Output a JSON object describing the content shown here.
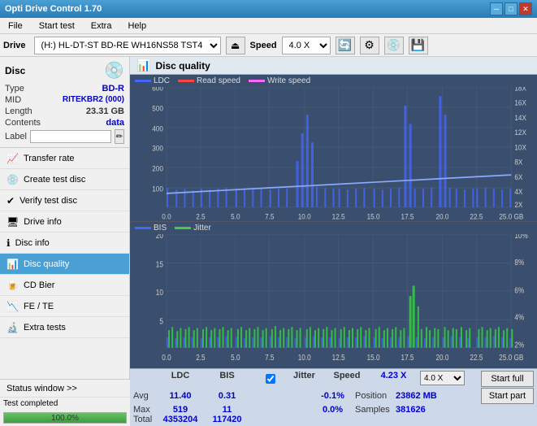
{
  "titleBar": {
    "title": "Opti Drive Control 1.70",
    "minimizeIcon": "─",
    "maximizeIcon": "□",
    "closeIcon": "✕"
  },
  "menuBar": {
    "items": [
      "File",
      "Start test",
      "Extra",
      "Help"
    ]
  },
  "driveToolbar": {
    "driveLabel": "Drive",
    "driveValue": "(H:) HL-DT-ST BD-RE  WH16NS58 TST4",
    "speedLabel": "Speed",
    "speedValue": "4.0 X"
  },
  "disc": {
    "title": "Disc",
    "typeLabel": "Type",
    "typeValue": "BD-R",
    "midLabel": "MID",
    "midValue": "RITEKBR2 (000)",
    "lengthLabel": "Length",
    "lengthValue": "23.31 GB",
    "contentsLabel": "Contents",
    "contentsValue": "data",
    "labelLabel": "Label",
    "labelValue": ""
  },
  "navItems": [
    {
      "id": "transfer-rate",
      "label": "Transfer rate",
      "icon": "📈"
    },
    {
      "id": "create-test-disc",
      "label": "Create test disc",
      "icon": "💿"
    },
    {
      "id": "verify-test-disc",
      "label": "Verify test disc",
      "icon": "✔"
    },
    {
      "id": "drive-info",
      "label": "Drive info",
      "icon": "🖥"
    },
    {
      "id": "disc-info",
      "label": "Disc info",
      "icon": "ℹ"
    },
    {
      "id": "disc-quality",
      "label": "Disc quality",
      "icon": "📊",
      "active": true
    },
    {
      "id": "cd-bier",
      "label": "CD Bier",
      "icon": "🍺"
    },
    {
      "id": "fe-te",
      "label": "FE / TE",
      "icon": "📉"
    },
    {
      "id": "extra-tests",
      "label": "Extra tests",
      "icon": "🔬"
    }
  ],
  "statusWindow": {
    "label": "Status window >>",
    "progressPct": 100,
    "progressLabel": "100.0%",
    "completedText": "Test completed"
  },
  "discQuality": {
    "title": "Disc quality",
    "icon": "📊",
    "legend1": {
      "ldc": "LDC",
      "read": "Read speed",
      "write": "Write speed"
    },
    "legend2": {
      "bis": "BIS",
      "jitter": "Jitter"
    },
    "chart1": {
      "yMax": 600,
      "yLabels": [
        "600",
        "500",
        "400",
        "300",
        "200",
        "100"
      ],
      "yRight": [
        "18X",
        "16X",
        "14X",
        "12X",
        "10X",
        "8X",
        "6X",
        "4X",
        "2X"
      ],
      "xLabels": [
        "0.0",
        "2.5",
        "5.0",
        "7.5",
        "10.0",
        "12.5",
        "15.0",
        "17.5",
        "20.0",
        "22.5",
        "25.0 GB"
      ]
    },
    "chart2": {
      "yMax": 20,
      "yLabels": [
        "20",
        "15",
        "10",
        "5"
      ],
      "yRight": [
        "10%",
        "8%",
        "6%",
        "4%",
        "2%"
      ],
      "xLabels": [
        "0.0",
        "2.5",
        "5.0",
        "7.5",
        "10.0",
        "12.5",
        "15.0",
        "17.5",
        "20.0",
        "22.5",
        "25.0 GB"
      ]
    }
  },
  "stats": {
    "headers": [
      "",
      "LDC",
      "BIS",
      "",
      "Jitter",
      "Speed",
      "",
      ""
    ],
    "avgLabel": "Avg",
    "avgLDC": "11.40",
    "avgBIS": "0.31",
    "avgJitter": "-0.1%",
    "maxLabel": "Max",
    "maxLDC": "519",
    "maxBIS": "11",
    "maxJitter": "0.0%",
    "totalLabel": "Total",
    "totalLDC": "4353204",
    "totalBIS": "117420",
    "speedLabel": "Speed",
    "speedValue": "4.23 X",
    "speedSelectValue": "4.0 X",
    "positionLabel": "Position",
    "positionValue": "23862 MB",
    "samplesLabel": "Samples",
    "samplesValue": "381626",
    "startFullLabel": "Start full",
    "startPartLabel": "Start part",
    "jitterChecked": true,
    "jitterLabel": "Jitter"
  }
}
